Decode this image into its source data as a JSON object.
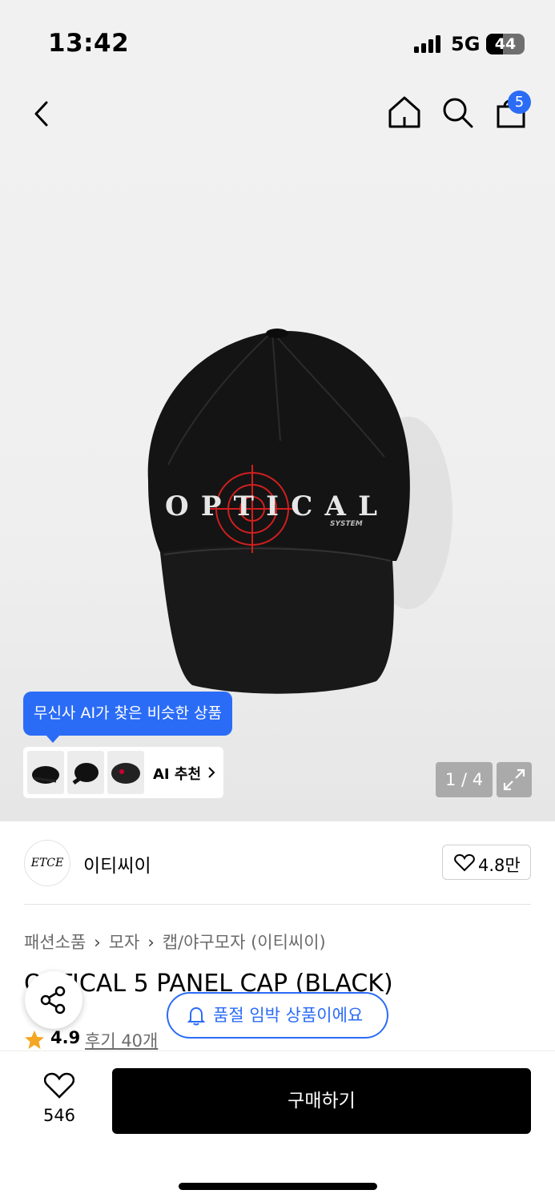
{
  "status_bar": {
    "time": "13:42",
    "network": "5G",
    "battery": "44",
    "battery_level": 0.44
  },
  "nav": {
    "back_icon": "chevron-left-icon",
    "home_icon": "home-icon",
    "search_icon": "search-icon",
    "cart_icon": "shopping-bag-icon",
    "cart_badge": "5"
  },
  "hero": {
    "cap_logo_text": "OPTICAL",
    "cap_logo_sub": "SYSTEM",
    "ai_tooltip": "무신사 AI가 찾은 비슷한 상품",
    "ai_recommend_label": "AI 추천",
    "page_indicator": "1 / 4",
    "expand_icon": "expand-icon"
  },
  "brand": {
    "logo_text": "ETCE",
    "name": "이티씨이",
    "likes": "4.8만"
  },
  "product": {
    "breadcrumb": [
      "패션소품",
      "모자",
      "캡/야구모자 (이티씨이)"
    ],
    "title": "OPTICAL 5 PANEL CAP (BLACK)",
    "rating": "4.9",
    "reviews": "후기 40개"
  },
  "soldout_notice": "품절 임박 상품이에요",
  "bottom": {
    "wish_count": "546",
    "buy_label": "구매하기"
  },
  "colors": {
    "accent": "#2b6cf6",
    "star": "#f5a623",
    "cap_red": "#d11f1f"
  }
}
